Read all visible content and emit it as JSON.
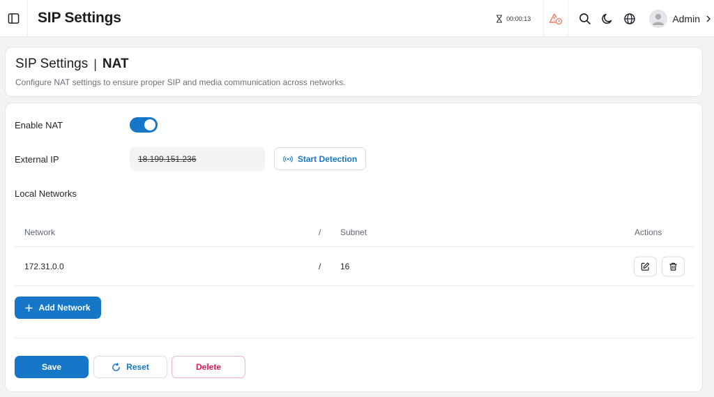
{
  "app": {
    "title": "SIP Settings"
  },
  "header": {
    "timer": "00:00:13",
    "user_name": "Admin"
  },
  "page": {
    "breadcrumb_parent": "SIP Settings",
    "breadcrumb_sep": "|",
    "breadcrumb_current": "NAT",
    "description": "Configure NAT settings to ensure proper SIP and media communication across networks."
  },
  "form": {
    "enable_nat_label": "Enable NAT",
    "enable_nat_value": true,
    "external_ip_label": "External IP",
    "external_ip_value": "18.199.151.236",
    "start_detection_label": "Start Detection",
    "local_networks_label": "Local Networks"
  },
  "table": {
    "headers": {
      "network": "Network",
      "slash": "/",
      "subnet": "Subnet",
      "actions": "Actions"
    },
    "rows": [
      {
        "network": "172.31.0.0",
        "slash": "/",
        "subnet": "16"
      }
    ]
  },
  "buttons": {
    "add_network": "Add Network",
    "save": "Save",
    "reset": "Reset",
    "delete": "Delete"
  },
  "colors": {
    "primary": "#1677c9",
    "danger": "#e0194f",
    "warning": "#f07a5a"
  }
}
